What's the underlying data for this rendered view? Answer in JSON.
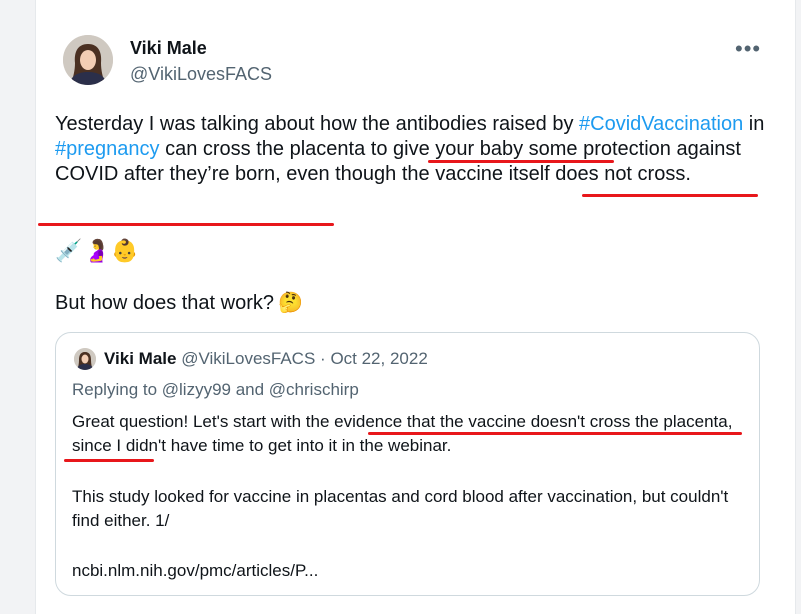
{
  "tweet": {
    "author_name": "Viki Male",
    "author_handle": "@VikiLovesFACS",
    "more_icon": "more-horizontal-icon",
    "text_part1": "Yesterday I was talking about how the antibodies raised by ",
    "hashtag1": "#CovidVaccination",
    "text_part2": " in ",
    "hashtag2": "#pregnancy",
    "text_part3": " can cross the placenta to give your baby some protection against COVID after they’re born, even though the vaccine itself does not cross.",
    "emojis": [
      "💉",
      "🤰",
      "👶"
    ],
    "question": "But how does that work?",
    "question_emoji": "🤔",
    "hashtag_color": "#1d9bf0"
  },
  "quote": {
    "author_name": "Viki Male",
    "author_handle": "@VikiLovesFACS",
    "separator": "·",
    "date": "Oct 22, 2022",
    "replying_to": "Replying to @lizyy99 and @chrischirp",
    "text": "Great question! Let's start with the evidence that the vaccine doesn't cross the placenta, since I didn't have time to get into it in the webinar.",
    "study_text": "This study looked for vaccine in placentas and cord blood after vaccination, but couldn't find either. 1/",
    "link": "ncbi.nlm.nih.gov/pmc/articles/P..."
  },
  "colors": {
    "underline": "#e8171b",
    "muted": "#536471",
    "border": "#cfd9de"
  }
}
